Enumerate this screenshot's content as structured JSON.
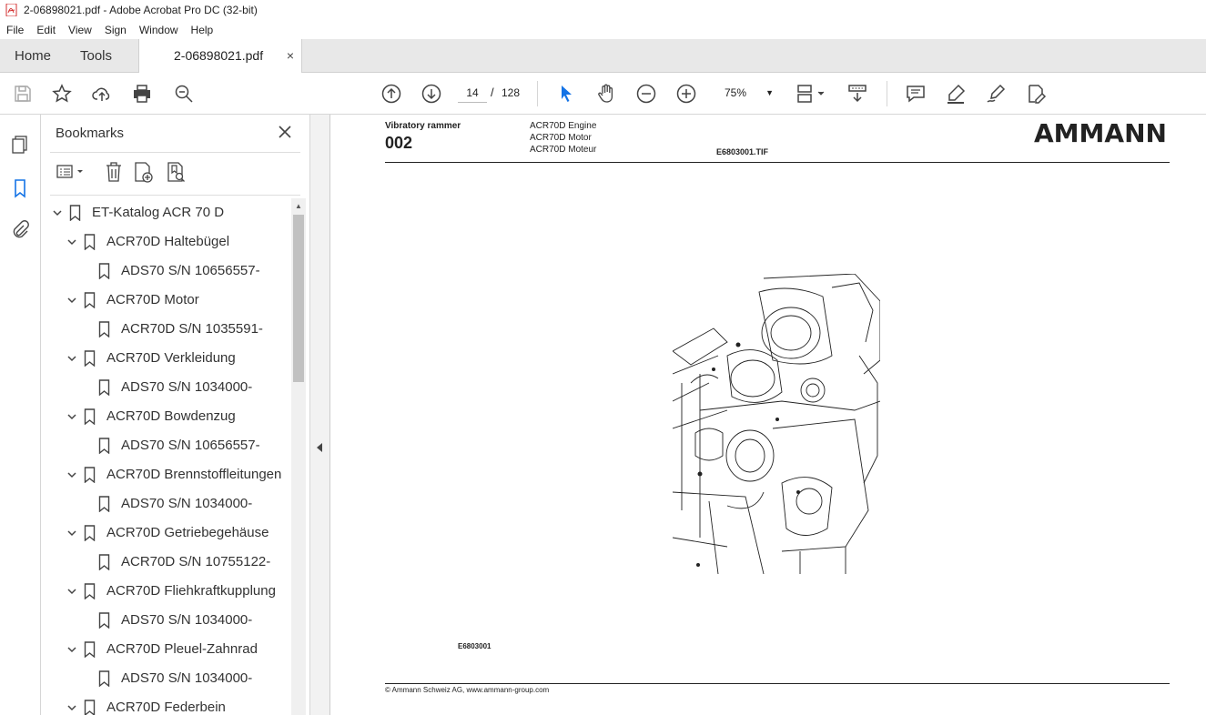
{
  "window": {
    "title": "2-06898021.pdf - Adobe Acrobat Pro DC (32-bit)"
  },
  "menu": [
    "File",
    "Edit",
    "View",
    "Sign",
    "Window",
    "Help"
  ],
  "tabs": {
    "home": "Home",
    "tools": "Tools",
    "document": "2-06898021.pdf",
    "close": "×"
  },
  "toolbar": {
    "page_current": "14",
    "page_sep": "/",
    "page_total": "128",
    "zoom": "75%"
  },
  "bookmarks": {
    "title": "Bookmarks",
    "items": [
      {
        "label": "ET-Katalog ACR 70 D",
        "level": 0,
        "expanded": true
      },
      {
        "label": "ACR70D Haltebügel",
        "level": 1,
        "expanded": true
      },
      {
        "label": "ADS70 S/N 10656557-",
        "level": 2
      },
      {
        "label": "ACR70D Motor",
        "level": 1,
        "expanded": true
      },
      {
        "label": "ACR70D S/N 1035591-",
        "level": 2
      },
      {
        "label": "ACR70D Verkleidung",
        "level": 1,
        "expanded": true
      },
      {
        "label": "ADS70 S/N 1034000-",
        "level": 2
      },
      {
        "label": "ACR70D Bowdenzug",
        "level": 1,
        "expanded": true
      },
      {
        "label": "ADS70 S/N 10656557-",
        "level": 2
      },
      {
        "label": "ACR70D Brennstoffleitungen",
        "level": 1,
        "expanded": true
      },
      {
        "label": "ADS70 S/N 1034000-",
        "level": 2
      },
      {
        "label": "ACR70D Getriebegehäuse",
        "level": 1,
        "expanded": true
      },
      {
        "label": "ACR70D S/N 10755122-",
        "level": 2
      },
      {
        "label": "ACR70D Fliehkraftkupplung",
        "level": 1,
        "expanded": true
      },
      {
        "label": "ADS70 S/N 1034000-",
        "level": 2
      },
      {
        "label": "ACR70D Pleuel-Zahnrad",
        "level": 1,
        "expanded": true
      },
      {
        "label": "ADS70 S/N 1034000-",
        "level": 2
      },
      {
        "label": "ACR70D Federbein",
        "level": 1,
        "expanded": true
      }
    ]
  },
  "document": {
    "title": "Vibratory rammer",
    "number": "002",
    "subtitles": [
      "ACR70D Engine",
      "ACR70D Motor",
      "ACR70D Moteur"
    ],
    "file": "E6803001.TIF",
    "logo": "AMMANN",
    "image_ref": "E6803001",
    "footer": "© Ammann Schweiz AG, www.ammann-group.com"
  },
  "colors": {
    "accent": "#1473e6",
    "text": "#222222",
    "tabbar": "#e8e8e8"
  }
}
